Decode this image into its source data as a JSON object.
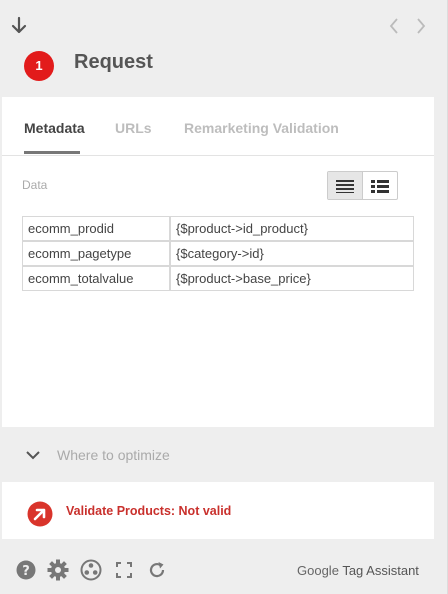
{
  "header": {
    "title": "Request",
    "badge_count": "1",
    "back_icon": "arrow-down-icon",
    "prev_icon": "chevron-left-icon",
    "next_icon": "chevron-right-icon"
  },
  "tabs": [
    {
      "label": "Metadata",
      "active": true
    },
    {
      "label": "URLs",
      "active": false
    },
    {
      "label": "Remarketing Validation",
      "active": false
    }
  ],
  "data_section": {
    "label": "Data",
    "view_options": [
      "list-view-icon",
      "detail-view-icon"
    ],
    "rows": [
      {
        "key": "ecomm_prodid",
        "value": "{$product->id_product}"
      },
      {
        "key": "ecomm_pagetype",
        "value": "{$category->id}"
      },
      {
        "key": "ecomm_totalvalue",
        "value": "{$product->base_price}"
      }
    ]
  },
  "optimize": {
    "label": "Where to optimize",
    "icon": "chevron-down-icon"
  },
  "validation": {
    "text": "Validate Products: Not valid",
    "status_color": "#c9302c",
    "icon": "arrow-upleft-icon"
  },
  "footer": {
    "icons": [
      "help-icon",
      "gear-icon",
      "network-icon",
      "fullscreen-icon",
      "refresh-icon"
    ],
    "brand_google": "Google",
    "brand_name": "Tag Assistant"
  },
  "colors": {
    "badge": "#e21b1b",
    "background": "#eeeeee"
  }
}
